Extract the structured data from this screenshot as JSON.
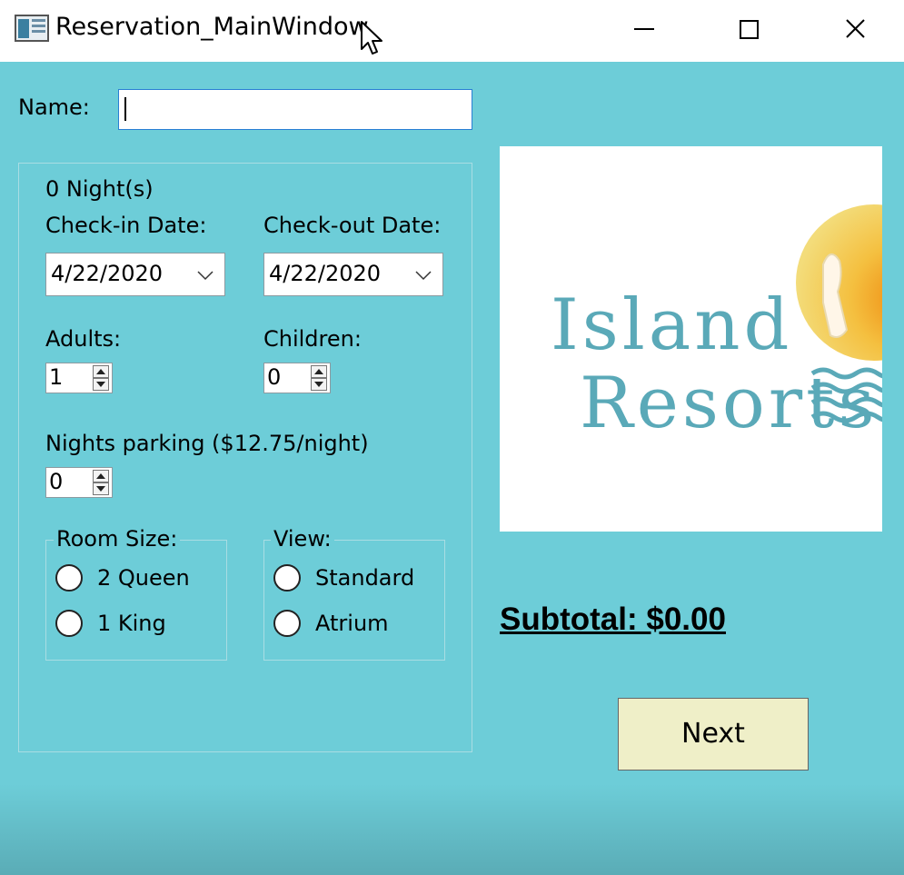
{
  "window": {
    "title": "Reservation_MainWindow"
  },
  "form": {
    "name_label": "Name:",
    "name_value": "",
    "nights_text": "0 Night(s)",
    "checkin_label": "Check-in Date:",
    "checkin_value": "4/22/2020",
    "checkout_label": "Check-out Date:",
    "checkout_value": "4/22/2020",
    "adults_label": "Adults:",
    "adults_value": "1",
    "children_label": "Children:",
    "children_value": "0",
    "parking_label": "Nights parking ($12.75/night)",
    "parking_value": "0",
    "room_size": {
      "title": "Room Size:",
      "options": [
        "2 Queen",
        "1 King"
      ]
    },
    "view": {
      "title": "View:",
      "options": [
        "Standard",
        "Atrium"
      ]
    }
  },
  "logo": {
    "line1": "Island",
    "line2": "Resorts"
  },
  "subtotal": "Subtotal: $0.00",
  "next_label": "Next",
  "icons": [
    "app-icon",
    "minimize-icon",
    "maximize-icon",
    "close-icon",
    "chevron-down-icon",
    "spin-arrows-icon",
    "mouse-cursor-icon"
  ],
  "colors": {
    "background": "#6dcdd8",
    "button": "#efefc8",
    "logo_text": "#5aa9b8"
  }
}
